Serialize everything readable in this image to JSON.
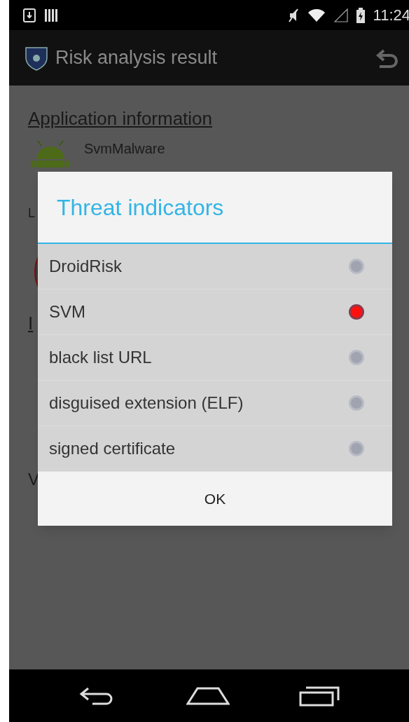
{
  "status_bar": {
    "time": "11:24"
  },
  "action_bar": {
    "title": "Risk analysis result"
  },
  "background": {
    "section_title": "Application information",
    "app_name": "SvmMalware",
    "fragments": [
      "L",
      "I",
      "V"
    ]
  },
  "dialog": {
    "title": "Threat indicators",
    "indicators": [
      {
        "label": "DroidRisk",
        "alert": false
      },
      {
        "label": "SVM",
        "alert": true
      },
      {
        "label": "black list URL",
        "alert": false
      },
      {
        "label": "disguised extension (ELF)",
        "alert": false
      },
      {
        "label": "signed certificate",
        "alert": false
      }
    ],
    "button": "OK"
  }
}
